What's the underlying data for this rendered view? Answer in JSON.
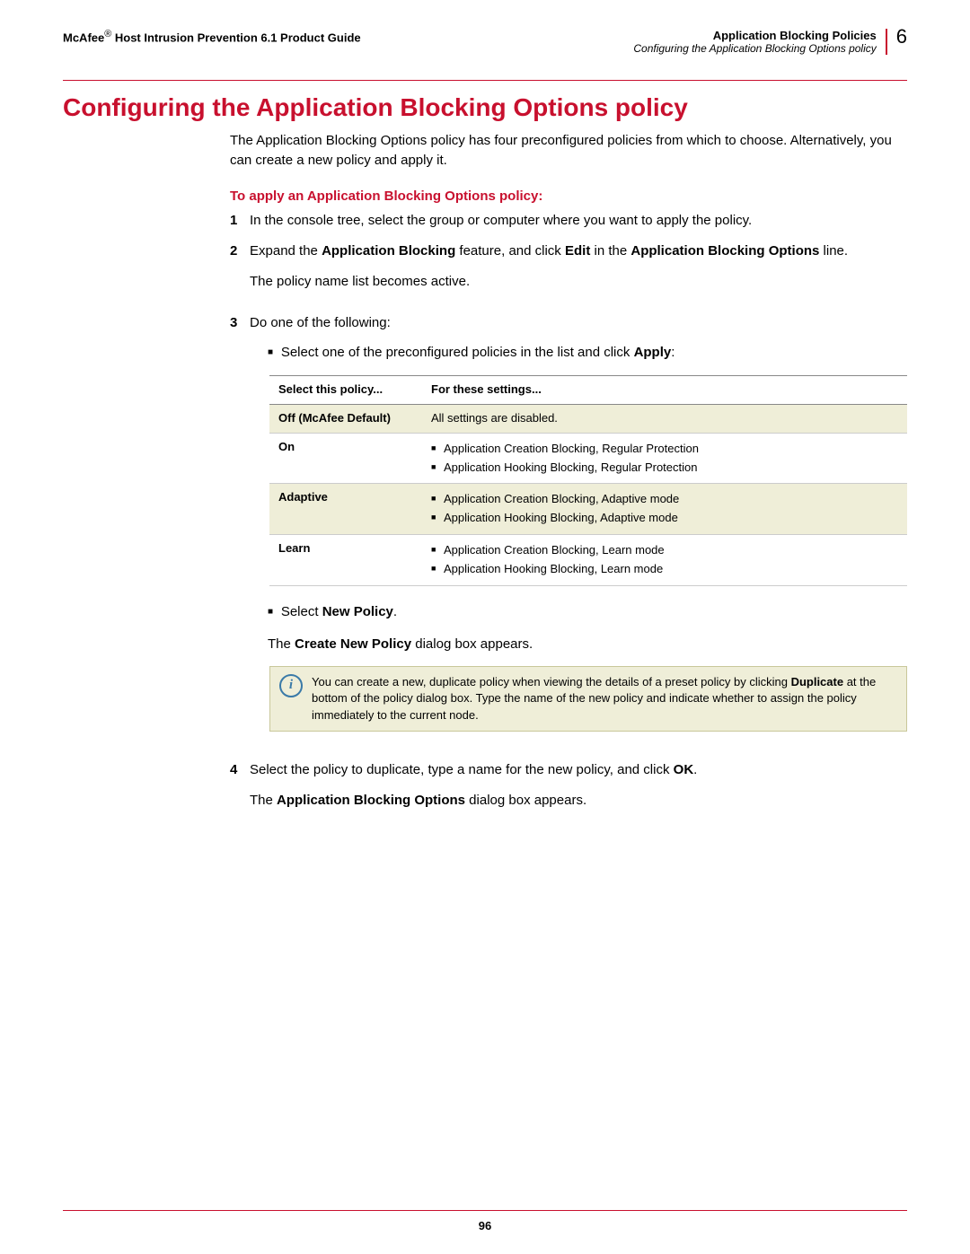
{
  "header": {
    "brand": "McAfee",
    "brand_suffix": "®",
    "doc_title": "Host Intrusion Prevention 6.1 Product Guide",
    "section": "Application Blocking Policies",
    "subsection": "Configuring the Application Blocking Options policy",
    "chapter_number": "6"
  },
  "title": "Configuring the Application Blocking Options policy",
  "intro": "The Application Blocking Options policy has four preconfigured policies from which to choose. Alternatively, you can create a new policy and apply it.",
  "procedure_heading": "To apply an Application Blocking Options policy:",
  "steps": {
    "s1": {
      "num": "1",
      "text": "In the console tree, select the group or computer where you want to apply the policy."
    },
    "s2": {
      "num": "2",
      "pre": "Expand the ",
      "bold1": "Application Blocking",
      "mid": " feature, and click ",
      "bold2": "Edit",
      "mid2": " in the ",
      "bold3": "Application Blocking Options",
      "post": " line.",
      "after": "The policy name list becomes active."
    },
    "s3": {
      "num": "3",
      "text": "Do one of the following:",
      "bullet1_pre": "Select one of the preconfigured policies in the list and click ",
      "bullet1_bold": "Apply",
      "bullet1_post": ":",
      "bullet2_pre": "Select ",
      "bullet2_bold": "New Policy",
      "bullet2_post": ".",
      "after_pre": "The ",
      "after_bold": "Create New Policy",
      "after_post": " dialog box appears."
    },
    "s4": {
      "num": "4",
      "pre": "Select the policy to duplicate, type a name for the new policy, and click ",
      "bold": "OK",
      "post": ".",
      "after_pre": "The ",
      "after_bold": "Application Blocking Options",
      "after_post": " dialog box appears."
    }
  },
  "table": {
    "col1": "Select this policy...",
    "col2": "For these settings...",
    "rows": [
      {
        "name": "Off (McAfee Default)",
        "settings_plain": "All settings are disabled."
      },
      {
        "name": "On",
        "settings_list": [
          "Application Creation Blocking, Regular Protection",
          "Application Hooking Blocking, Regular Protection"
        ]
      },
      {
        "name": "Adaptive",
        "settings_list": [
          "Application Creation Blocking, Adaptive mode",
          "Application Hooking Blocking, Adaptive mode"
        ]
      },
      {
        "name": "Learn",
        "settings_list": [
          "Application Creation Blocking, Learn mode",
          "Application Hooking Blocking, Learn mode"
        ]
      }
    ]
  },
  "note": {
    "pre": "You can create a new, duplicate policy when viewing the details of a preset policy by clicking ",
    "bold": "Duplicate",
    "post": " at the bottom of the policy dialog box. Type the name of the new policy and indicate whether to assign the policy immediately to the current node."
  },
  "page_number": "96"
}
